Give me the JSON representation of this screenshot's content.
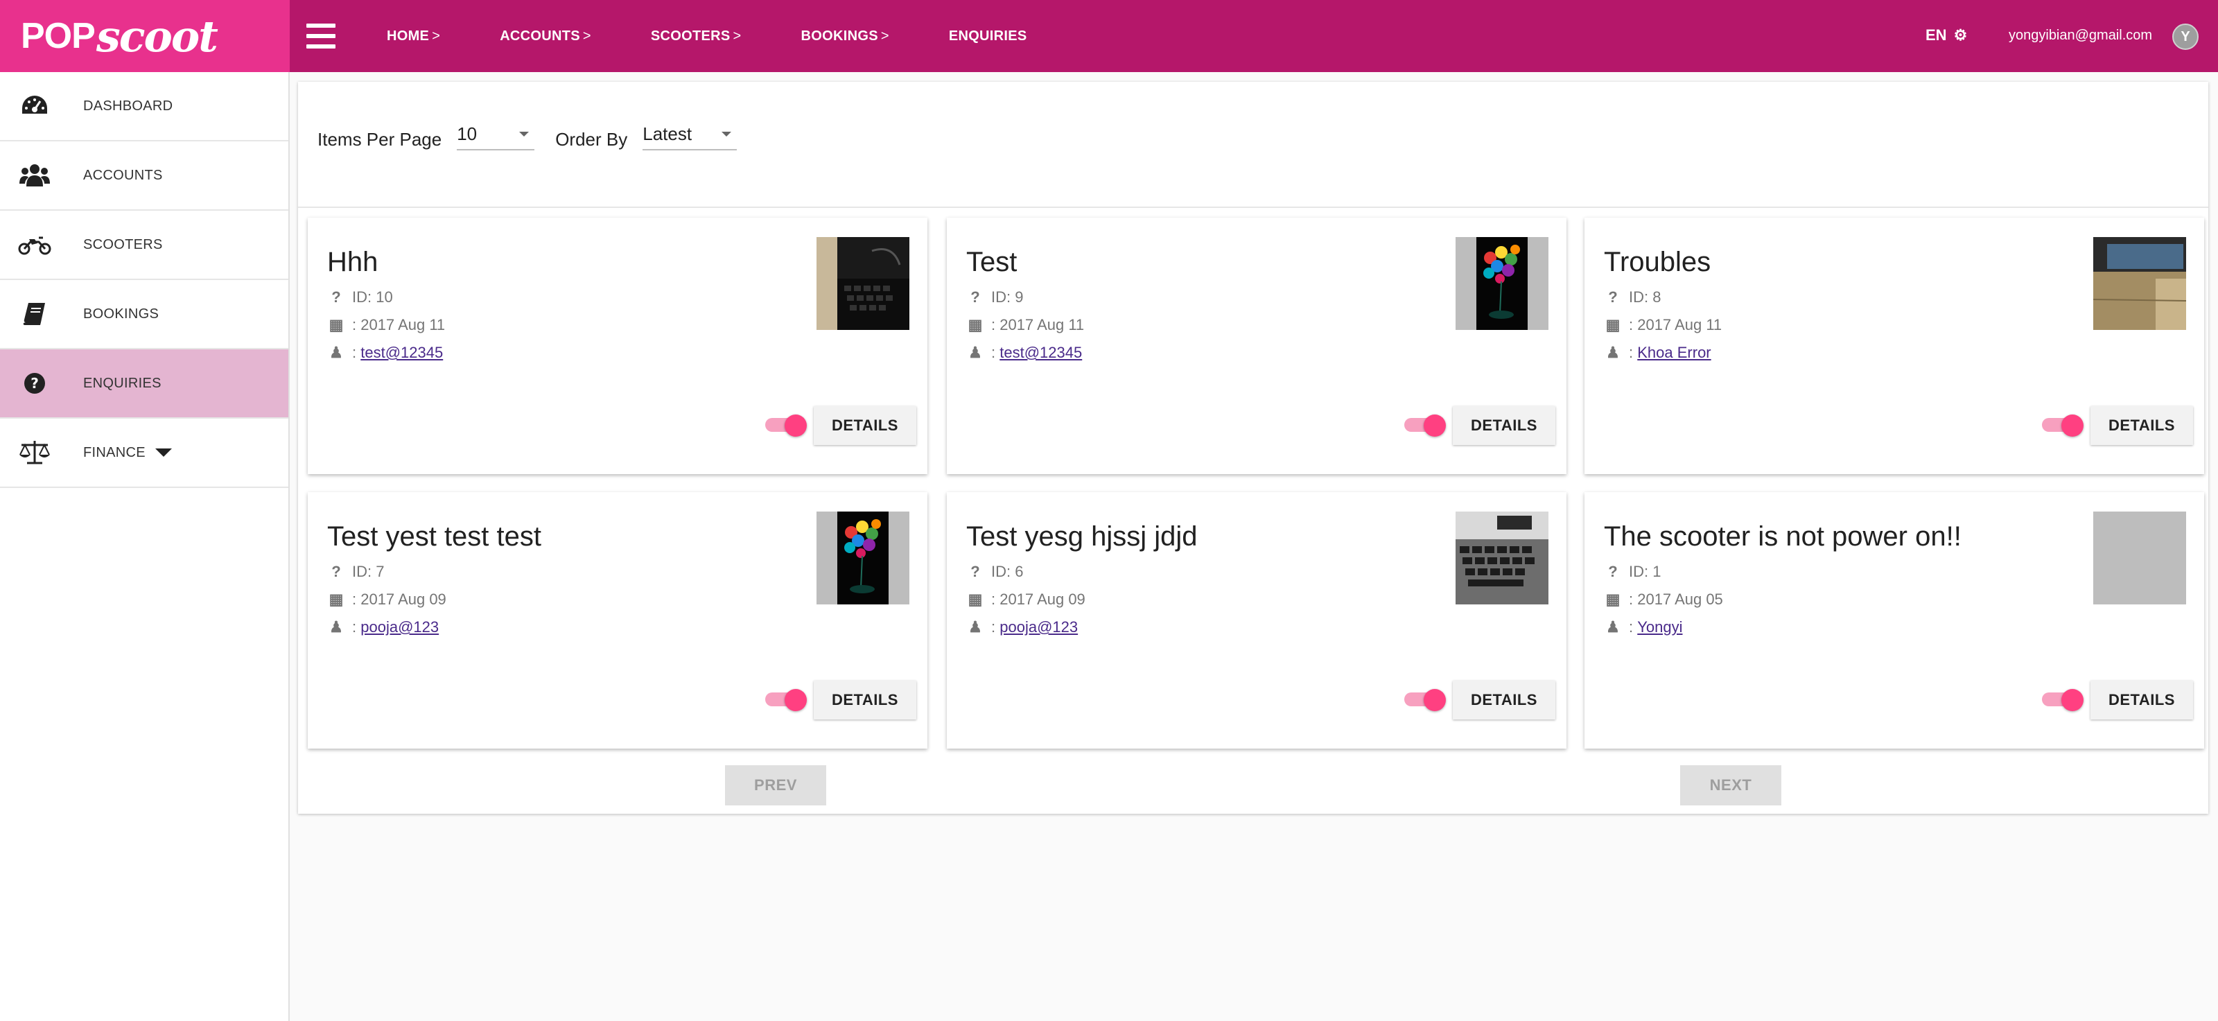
{
  "brand": {
    "logo_pop": "POP",
    "logo_scoot": "scoot",
    "primary_color": "#b5176a",
    "logo_bg": "#e8318d",
    "accent": "#ff4081"
  },
  "topnav": {
    "items": [
      {
        "label": "HOME",
        "chevron": ">"
      },
      {
        "label": "ACCOUNTS",
        "chevron": ">"
      },
      {
        "label": "SCOOTERS",
        "chevron": ">"
      },
      {
        "label": "BOOKINGS",
        "chevron": ">"
      },
      {
        "label": "ENQUIRIES",
        "chevron": ""
      }
    ],
    "language": "EN",
    "user_email": "yongyibian@gmail.com",
    "avatar_initial": "Y"
  },
  "sidebar": {
    "items": [
      {
        "label": "DASHBOARD",
        "icon": "dashboard-icon"
      },
      {
        "label": "ACCOUNTS",
        "icon": "users-icon"
      },
      {
        "label": "SCOOTERS",
        "icon": "motorcycle-icon"
      },
      {
        "label": "BOOKINGS",
        "icon": "book-icon"
      },
      {
        "label": "ENQUIRIES",
        "icon": "question-circle-icon",
        "active": true
      },
      {
        "label": "FINANCE",
        "icon": "balance-scale-icon",
        "has_dropdown": true
      }
    ]
  },
  "filters": {
    "items_per_page_label": "Items Per Page",
    "items_per_page_value": "10",
    "order_by_label": "Order By",
    "order_by_value": "Latest"
  },
  "enquiries": [
    {
      "title": "Hhh",
      "id": "ID: 10",
      "date": ": 2017 Aug 11",
      "user_prefix": ":",
      "user": "test@12345",
      "enabled": true,
      "image": "keyboard"
    },
    {
      "title": "Test",
      "id": "ID: 9",
      "date": ": 2017 Aug 11",
      "user_prefix": ":",
      "user": "test@12345",
      "enabled": true,
      "image": "balloons"
    },
    {
      "title": "Troubles",
      "id": "ID: 8",
      "date": ": 2017 Aug 11",
      "user_prefix": ":",
      "user": "Khoa Error",
      "enabled": true,
      "image": "desk"
    },
    {
      "title": "Test yest test test",
      "id": "ID: 7",
      "date": ": 2017 Aug 09",
      "user_prefix": ":",
      "user": "pooja@123",
      "enabled": true,
      "image": "balloons"
    },
    {
      "title": "Test yesg hjssj jdjd",
      "id": "ID: 6",
      "date": ": 2017 Aug 09",
      "user_prefix": ":",
      "user": "pooja@123",
      "enabled": true,
      "image": "laptop"
    },
    {
      "title": "The scooter is not power on!!",
      "id": "ID: 1",
      "date": ": 2017 Aug 05",
      "user_prefix": ":",
      "user": "Yongyi",
      "enabled": true,
      "image": "none"
    }
  ],
  "card_button_label": "DETAILS",
  "pagination": {
    "prev_label": "PREV",
    "next_label": "NEXT"
  }
}
